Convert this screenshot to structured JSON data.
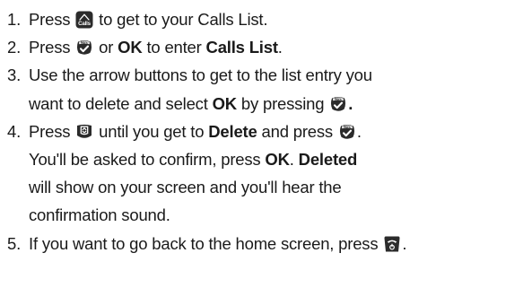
{
  "steps": [
    {
      "number": "1.",
      "lines": [
        [
          {
            "type": "text",
            "text": "Press "
          },
          {
            "type": "icon",
            "icon": "calls-icon",
            "glyph": "calls",
            "label": "Calls"
          },
          {
            "type": "text",
            "text": " to get to your Calls List."
          }
        ]
      ]
    },
    {
      "number": "2.",
      "lines": [
        [
          {
            "type": "text",
            "text": "Press "
          },
          {
            "type": "icon",
            "icon": "menu-ok-icon",
            "glyph": "menu",
            "label": "Menu"
          },
          {
            "type": "text",
            "text": " or "
          },
          {
            "type": "bold",
            "text": "OK"
          },
          {
            "type": "text",
            "text": " to enter "
          },
          {
            "type": "bold",
            "text": "Calls List"
          },
          {
            "type": "text",
            "text": "."
          }
        ]
      ]
    },
    {
      "number": "3.",
      "lines": [
        [
          {
            "type": "text",
            "text": "Use the arrow buttons to get to the list entry you"
          }
        ],
        [
          {
            "type": "text",
            "text": "want to delete and select "
          },
          {
            "type": "bold",
            "text": "OK"
          },
          {
            "type": "text",
            "text": " by pressing "
          },
          {
            "type": "icon",
            "icon": "menu-ok-icon",
            "glyph": "menu",
            "label": "Menu"
          },
          {
            "type": "bold",
            "text": "."
          }
        ]
      ]
    },
    {
      "number": "4.",
      "lines": [
        [
          {
            "type": "text",
            "text": "Press "
          },
          {
            "type": "icon",
            "icon": "navigation-icon",
            "glyph": "nav",
            "label": ""
          },
          {
            "type": "text",
            "text": " until you get to "
          },
          {
            "type": "bold",
            "text": "Delete"
          },
          {
            "type": "text",
            "text": " and press "
          },
          {
            "type": "icon",
            "icon": "menu-ok-icon",
            "glyph": "menu",
            "label": "Menu"
          },
          {
            "type": "text",
            "text": "."
          }
        ],
        [
          {
            "type": "text",
            "text": "You'll be asked to confirm, press "
          },
          {
            "type": "bold",
            "text": "OK"
          },
          {
            "type": "text",
            "text": ". "
          },
          {
            "type": "bold",
            "text": "Deleted"
          }
        ],
        [
          {
            "type": "text",
            "text": "will show on your screen and you'll hear the"
          }
        ],
        [
          {
            "type": "text",
            "text": "confirmation sound."
          }
        ]
      ]
    },
    {
      "number": "5.",
      "lines": [
        [
          {
            "type": "text",
            "text": "If you want to go back to the home screen, press "
          },
          {
            "type": "icon",
            "icon": "end-call-icon",
            "glyph": "endcall",
            "label": ""
          },
          {
            "type": "text",
            "text": "."
          }
        ]
      ]
    }
  ],
  "colors": {
    "text": "#1a1a1a",
    "icon_background": "#2b2b2b",
    "icon_foreground": "#ffffff"
  }
}
